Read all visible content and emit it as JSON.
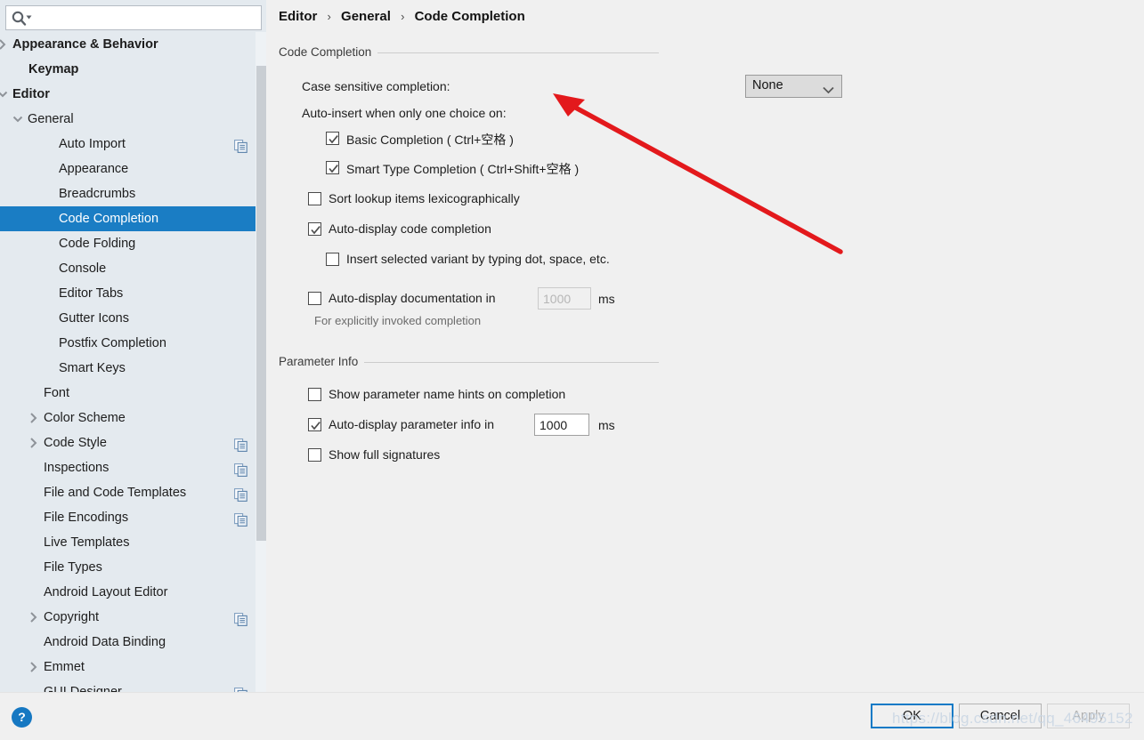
{
  "search": {
    "placeholder": "",
    "value": "",
    "icon": "search-icon"
  },
  "sidebar": {
    "items": [
      {
        "label": "Appearance & Behavior",
        "indent": 14,
        "twisty": "collapsed",
        "bold": true,
        "copy": false
      },
      {
        "label": "Keymap",
        "indent": 32,
        "twisty": "none",
        "bold": true,
        "copy": false
      },
      {
        "label": "Editor",
        "indent": 14,
        "twisty": "expanded",
        "bold": true,
        "copy": false
      },
      {
        "label": "General",
        "indent": 31,
        "twisty": "expanded",
        "bold": false,
        "copy": false
      },
      {
        "label": "Auto Import",
        "indent": 66,
        "twisty": "none",
        "bold": false,
        "copy": true
      },
      {
        "label": "Appearance",
        "indent": 66,
        "twisty": "none",
        "bold": false,
        "copy": false
      },
      {
        "label": "Breadcrumbs",
        "indent": 66,
        "twisty": "none",
        "bold": false,
        "copy": false
      },
      {
        "label": "Code Completion",
        "indent": 66,
        "twisty": "none",
        "bold": false,
        "copy": false,
        "selected": true
      },
      {
        "label": "Code Folding",
        "indent": 66,
        "twisty": "none",
        "bold": false,
        "copy": false
      },
      {
        "label": "Console",
        "indent": 66,
        "twisty": "none",
        "bold": false,
        "copy": false
      },
      {
        "label": "Editor Tabs",
        "indent": 66,
        "twisty": "none",
        "bold": false,
        "copy": false
      },
      {
        "label": "Gutter Icons",
        "indent": 66,
        "twisty": "none",
        "bold": false,
        "copy": false
      },
      {
        "label": "Postfix Completion",
        "indent": 66,
        "twisty": "none",
        "bold": false,
        "copy": false
      },
      {
        "label": "Smart Keys",
        "indent": 66,
        "twisty": "none",
        "bold": false,
        "copy": false
      },
      {
        "label": "Font",
        "indent": 49,
        "twisty": "none",
        "bold": false,
        "copy": false
      },
      {
        "label": "Color Scheme",
        "indent": 49,
        "twisty": "collapsed",
        "bold": false,
        "copy": false
      },
      {
        "label": "Code Style",
        "indent": 49,
        "twisty": "collapsed",
        "bold": false,
        "copy": true
      },
      {
        "label": "Inspections",
        "indent": 49,
        "twisty": "none",
        "bold": false,
        "copy": true
      },
      {
        "label": "File and Code Templates",
        "indent": 49,
        "twisty": "none",
        "bold": false,
        "copy": true
      },
      {
        "label": "File Encodings",
        "indent": 49,
        "twisty": "none",
        "bold": false,
        "copy": true
      },
      {
        "label": "Live Templates",
        "indent": 49,
        "twisty": "none",
        "bold": false,
        "copy": false
      },
      {
        "label": "File Types",
        "indent": 49,
        "twisty": "none",
        "bold": false,
        "copy": false
      },
      {
        "label": "Android Layout Editor",
        "indent": 49,
        "twisty": "none",
        "bold": false,
        "copy": false
      },
      {
        "label": "Copyright",
        "indent": 49,
        "twisty": "collapsed",
        "bold": false,
        "copy": true
      },
      {
        "label": "Android Data Binding",
        "indent": 49,
        "twisty": "none",
        "bold": false,
        "copy": false
      },
      {
        "label": "Emmet",
        "indent": 49,
        "twisty": "collapsed",
        "bold": false,
        "copy": false
      },
      {
        "label": "GUI Designer",
        "indent": 49,
        "twisty": "none",
        "bold": false,
        "copy": true
      }
    ]
  },
  "breadcrumb": {
    "part1": "Editor",
    "part2": "General",
    "part3": "Code Completion",
    "separator": "›"
  },
  "code_completion": {
    "group_title": "Code Completion",
    "case_sensitive_label": "Case sensitive completion:",
    "case_sensitive_value": "None",
    "auto_insert_label": "Auto-insert when only one choice on:",
    "basic_completion": {
      "label": "Basic Completion ( Ctrl+空格 )",
      "checked": true
    },
    "smart_type_completion": {
      "label": "Smart Type Completion ( Ctrl+Shift+空格 )",
      "checked": true
    },
    "sort_lookup": {
      "label": "Sort lookup items lexicographically",
      "checked": false
    },
    "auto_display_code": {
      "label": "Auto-display code completion",
      "checked": true
    },
    "insert_selected_variant": {
      "label": "Insert selected variant by typing dot, space, etc.",
      "checked": false
    },
    "auto_display_doc": {
      "label": "Auto-display documentation in",
      "checked": false
    },
    "auto_display_doc_value": "1000",
    "auto_display_doc_unit": "ms",
    "auto_display_doc_hint": "For explicitly invoked completion"
  },
  "parameter_info": {
    "group_title": "Parameter Info",
    "show_param_hints": {
      "label": "Show parameter name hints on completion",
      "checked": false
    },
    "auto_display_param": {
      "label": "Auto-display parameter info in",
      "checked": true
    },
    "auto_display_param_value": "1000",
    "auto_display_param_unit": "ms",
    "show_full_signatures": {
      "label": "Show full signatures",
      "checked": false
    }
  },
  "footer": {
    "help_label": "?",
    "ok_label": "OK",
    "cancel_label": "Cancel",
    "apply_label": "Apply",
    "watermark": "https://blog.csdn.net/qq_46495152"
  },
  "colors": {
    "selection_blue": "#1a7dc4",
    "sidebar_bg": "#e4eaef",
    "panel_bg": "#f0f0f0",
    "annotation_red": "#e3191c",
    "focus_blue": "#0f7ac6"
  }
}
